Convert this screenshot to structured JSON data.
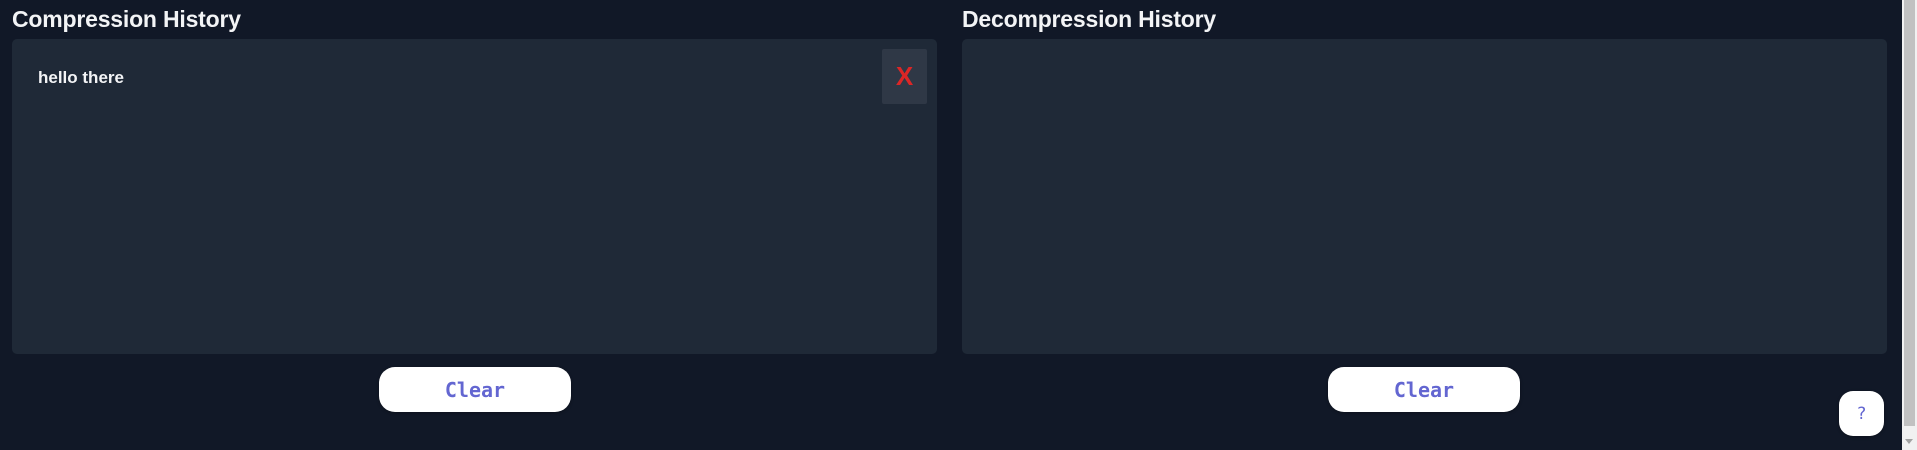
{
  "compression": {
    "title": "Compression History",
    "items": [
      {
        "text": "hello there",
        "delete_label": "X"
      }
    ],
    "clear_label": "Clear"
  },
  "decompression": {
    "title": "Decompression History",
    "items": [],
    "clear_label": "Clear"
  },
  "help": {
    "label": "?"
  },
  "colors": {
    "page_background": "#111827",
    "panel_background": "#1f2937",
    "delete_button_background": "#2f3846",
    "delete_icon": "#dc2626",
    "button_text": "#6366d1",
    "button_background": "#ffffff",
    "title_text": "#f3f4f6"
  }
}
